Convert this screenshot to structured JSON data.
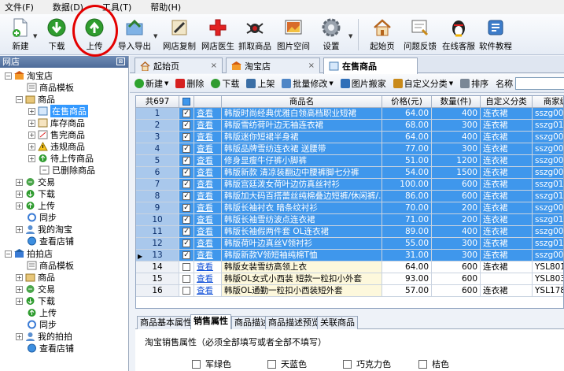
{
  "menu": [
    "文件(F)",
    "数据(D)",
    "工具(T)",
    "帮助(H)"
  ],
  "toolbar": {
    "new": "新建",
    "download": "下载",
    "upload": "上传",
    "import_export": "导入导出",
    "copy": "网店复制",
    "doctor": "网店医生",
    "grab": "抓取商品",
    "image_space": "图片空间",
    "settings": "设置",
    "home": "起始页",
    "feedback": "问题反馈",
    "support": "在线客服",
    "tutorial": "软件教程"
  },
  "left_panel": {
    "title": "网店",
    "pin": "⊠",
    "tree": {
      "taobao": "淘宝店",
      "tb_template": "商品模板",
      "tb_goods": "商品",
      "on_sale": "在售商品",
      "stock": "库存商品",
      "sold_out": "售完商品",
      "violation": "违规商品",
      "pending_upload": "待上传商品",
      "deleted": "已删除商品",
      "trade": "交易",
      "download": "下载",
      "upload": "上传",
      "sync": "同步",
      "my_taobao": "我的淘宝",
      "view_shop": "查看店铺",
      "paipai": "拍拍店",
      "pp_template": "商品模板",
      "pp_goods": "商品",
      "pp_trade": "交易",
      "pp_download": "下载",
      "pp_upload": "上传",
      "pp_sync": "同步",
      "my_paipai": "我的拍拍",
      "pp_view_shop": "查看店铺"
    }
  },
  "tabs": {
    "start": "起始页",
    "taobao": "淘宝店",
    "on_sale": "在售商品",
    "close": "×"
  },
  "subbar": {
    "new": "新建",
    "delete": "删除",
    "download": "下载",
    "list": "上架",
    "batch": "批量修改",
    "image_move": "图片搬家",
    "custom_cat": "自定义分类",
    "sort": "排序",
    "name_label": "名称"
  },
  "grid": {
    "count": "共697",
    "headers": {
      "name": "商品名",
      "price": "价格(元)",
      "qty": "数量(件)",
      "category": "自定义分类",
      "code": "商家编"
    },
    "view": "查看",
    "rows": [
      {
        "idx": "1",
        "name": "韩版时尚经典优雅白领高档职业短裙",
        "price": "64.00",
        "qty": "400",
        "cat": "连衣裙",
        "code": "sszg001",
        "sel": true
      },
      {
        "idx": "2",
        "name": "韩版雪纺荷叶边无袖连衣裙",
        "price": "68.00",
        "qty": "300",
        "cat": "连衣裙",
        "code": "sszg013",
        "sel": true
      },
      {
        "idx": "3",
        "name": "韩版迷你短裙半身裙",
        "price": "64.00",
        "qty": "400",
        "cat": "连衣裙",
        "code": "sszg009",
        "sel": true
      },
      {
        "idx": "4",
        "name": "韩版品牌雪纺连衣裙 送腰带",
        "price": "77.00",
        "qty": "300",
        "cat": "连衣裙",
        "code": "sszg005",
        "sel": true
      },
      {
        "idx": "5",
        "name": "修身显瘦牛仔裤小脚裤",
        "price": "51.00",
        "qty": "1200",
        "cat": "连衣裙",
        "code": "sszg002",
        "sel": true
      },
      {
        "idx": "6",
        "name": "韩版新款 清凉装翻边中腰裤脚七分裤",
        "price": "54.00",
        "qty": "1500",
        "cat": "连衣裙",
        "code": "sszg003",
        "sel": true
      },
      {
        "idx": "7",
        "name": "韩版宫廷泼女荷叶边仿真丝衬衫",
        "price": "100.00",
        "qty": "600",
        "cat": "连衣裙",
        "code": "sszg015",
        "sel": true
      },
      {
        "idx": "8",
        "name": "韩版加大码百搭蕾丝纯棉叠边短裤/休闲裤/...",
        "price": "86.00",
        "qty": "600",
        "cat": "连衣裙",
        "code": "sszg014",
        "sel": true
      },
      {
        "idx": "9",
        "name": "韩版长袖衬衣 暗条纹衬衫",
        "price": "70.00",
        "qty": "200",
        "cat": "连衣裙",
        "code": "sszg008",
        "sel": true
      },
      {
        "idx": "10",
        "name": "韩版长袖雪纺波点连衣裙",
        "price": "71.00",
        "qty": "200",
        "cat": "连衣裙",
        "code": "sszg012",
        "sel": true
      },
      {
        "idx": "11",
        "name": "韩版长袖假两件套 OL连衣裙",
        "price": "89.00",
        "qty": "400",
        "cat": "连衣裙",
        "code": "sszg004",
        "sel": true
      },
      {
        "idx": "12",
        "name": "韩版荷叶边真丝V领衬衫",
        "price": "55.00",
        "qty": "300",
        "cat": "连衣裙",
        "code": "sszg010",
        "sel": true
      },
      {
        "idx": "13",
        "name": "韩版新款V领短袖纯棉T恤",
        "price": "31.00",
        "qty": "300",
        "cat": "连衣裙",
        "code": "sszg006",
        "sel": true,
        "current": true
      },
      {
        "idx": "14",
        "name": "韩版女装雪纺高领上衣",
        "price": "64.00",
        "qty": "600",
        "cat": "连衣裙",
        "code": "YSL8016",
        "sel": false
      },
      {
        "idx": "15",
        "name": "韩版OL女式小西装 短款一粒扣小外套",
        "price": "93.00",
        "qty": "600",
        "cat": "",
        "code": "YSL8031",
        "sel": false
      },
      {
        "idx": "16",
        "name": "韩版OL通勤一粒扣小西装短外套",
        "price": "57.00",
        "qty": "600",
        "cat": "连衣裙",
        "code": "YSL1780",
        "sel": false
      }
    ]
  },
  "bottom_tabs": [
    "商品基本属性",
    "销售属性",
    "商品描述",
    "商品描述预览",
    "关联商品"
  ],
  "bottom_panel": {
    "title": "淘宝销售属性（必须全部填写或者全部不填写）",
    "colors": [
      "军绿色",
      "天蓝色",
      "巧克力色",
      "桔色"
    ]
  }
}
